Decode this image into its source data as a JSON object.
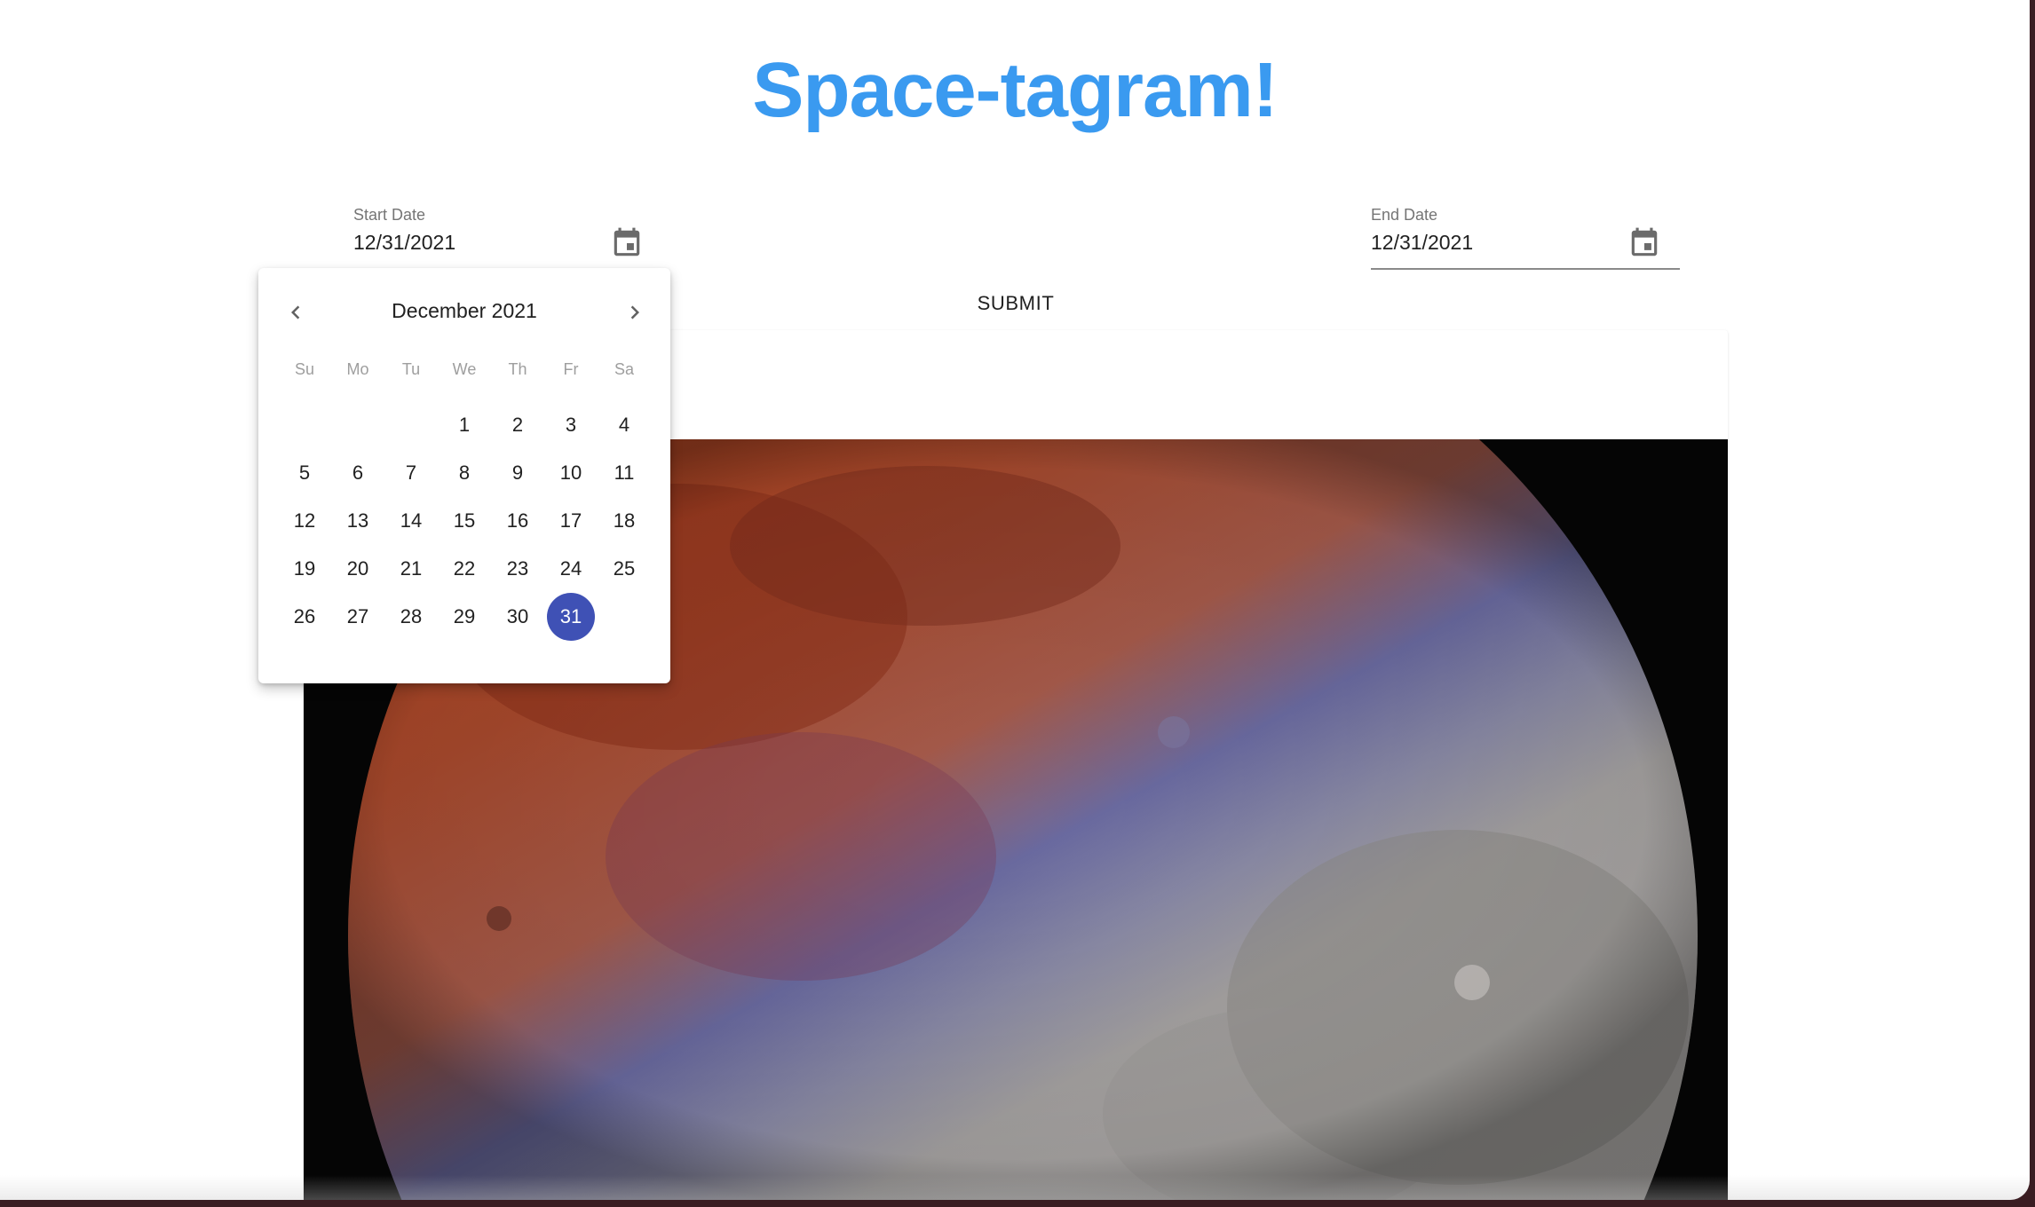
{
  "app": {
    "title": "Space-tagram!"
  },
  "start_date": {
    "label": "Start Date",
    "value": "12/31/2021"
  },
  "end_date": {
    "label": "End Date",
    "value": "12/31/2021"
  },
  "submit_label": "SUBMIT",
  "calendar": {
    "month_label": "December 2021",
    "weekdays": [
      "Su",
      "Mo",
      "Tu",
      "We",
      "Th",
      "Fr",
      "Sa"
    ],
    "leading_blanks": 3,
    "days": [
      "1",
      "2",
      "3",
      "4",
      "5",
      "6",
      "7",
      "8",
      "9",
      "10",
      "11",
      "12",
      "13",
      "14",
      "15",
      "16",
      "17",
      "18",
      "19",
      "20",
      "21",
      "22",
      "23",
      "24",
      "25",
      "26",
      "27",
      "28",
      "29",
      "30",
      "31"
    ],
    "selected_day": "31",
    "selected_color": "#3f51b5"
  },
  "colors": {
    "title": "#3a9af0",
    "link": "#1976d2"
  }
}
